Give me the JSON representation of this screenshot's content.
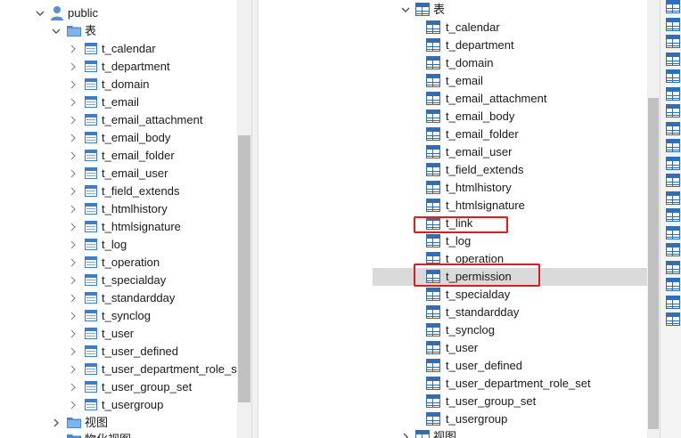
{
  "left": {
    "schema_label": "public",
    "tables_folder_label": "表",
    "tables": [
      "t_calendar",
      "t_department",
      "t_domain",
      "t_email",
      "t_email_attachment",
      "t_email_body",
      "t_email_folder",
      "t_email_user",
      "t_field_extends",
      "t_htmlhistory",
      "t_htmlsignature",
      "t_log",
      "t_operation",
      "t_specialday",
      "t_standardday",
      "t_synclog",
      "t_user",
      "t_user_defined",
      "t_user_department_role_set",
      "t_user_group_set",
      "t_usergroup"
    ],
    "views_label": "视图",
    "cut_label": "物化视图"
  },
  "right": {
    "tables_folder_label": "表",
    "tables": [
      "t_calendar",
      "t_department",
      "t_domain",
      "t_email",
      "t_email_attachment",
      "t_email_body",
      "t_email_folder",
      "t_email_user",
      "t_field_extends",
      "t_htmlhistory",
      "t_htmlsignature",
      "t_link",
      "t_log",
      "t_operation",
      "t_permission",
      "t_specialday",
      "t_standardday",
      "t_synclog",
      "t_user",
      "t_user_defined",
      "t_user_department_role_set",
      "t_user_group_set",
      "t_usergroup"
    ],
    "selected_item": "t_permission",
    "highlighted_items": [
      "t_link",
      "t_permission"
    ],
    "views_label": "视图"
  },
  "colors": {
    "highlight_box": "#e11b1b",
    "selection_bg": "#dadada",
    "table_icon": "#2e6fb8"
  }
}
